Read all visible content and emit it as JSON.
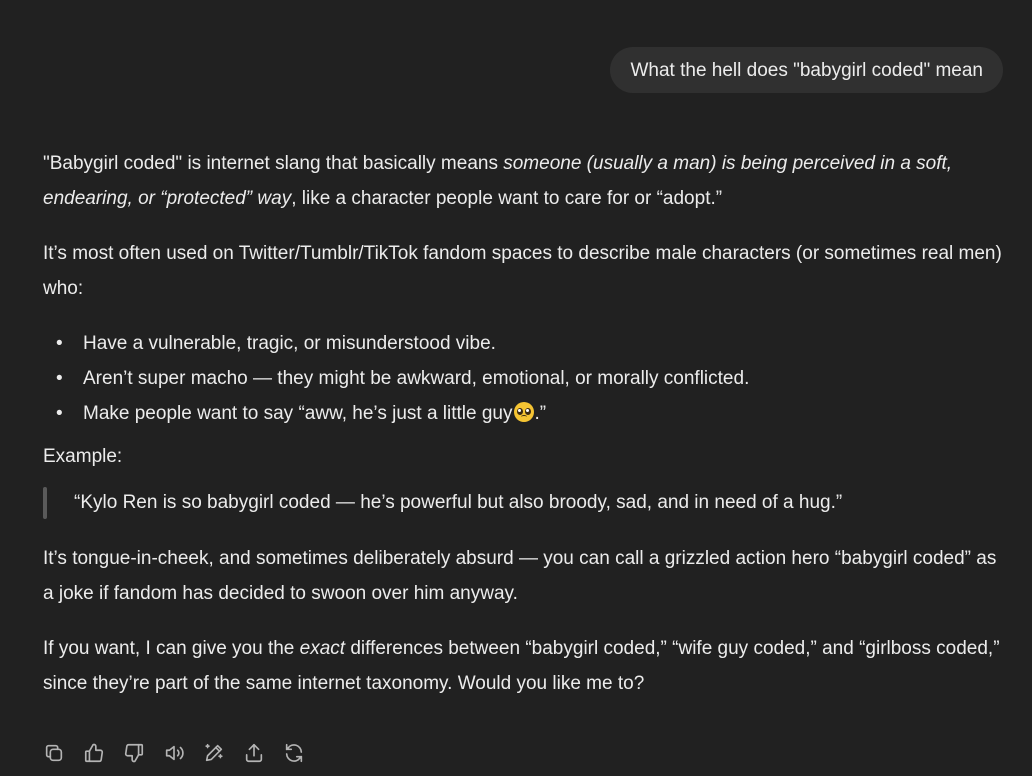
{
  "user_message": "What the hell does \"babygirl coded\" mean",
  "assistant": {
    "p1_before": "\"Babygirl coded\" is internet slang that basically means ",
    "p1_italic": "someone (usually a man) is being perceived in a soft, endearing, or “protected” way",
    "p1_after": ", like a character people want to care for or “adopt.”",
    "p2": "It’s most often used on Twitter/Tumblr/TikTok fandom spaces to describe male characters (or sometimes real men) who:",
    "bullets": [
      "Have a vulnerable, tragic, or misunderstood vibe.",
      "Aren’t super macho — they might be awkward, emotional, or morally conflicted.",
      "Make people want to say “aww, he’s just a little guy"
    ],
    "bullet3_after_emoji": ".”",
    "bullet_symbol": "•",
    "emoji_name": "pleading-face-emoji",
    "example_label": "Example:",
    "quote": "“Kylo Ren is so babygirl coded — he’s powerful but also broody, sad, and in need of a hug.”",
    "p3": "It’s tongue-in-cheek, and sometimes deliberately absurd — you can call a grizzled action hero “babygirl coded” as a joke if fandom has decided to swoon over him anyway.",
    "p4_before": "If you want, I can give you the ",
    "p4_italic": "exact",
    "p4_after": " differences between “babygirl coded,” “wife guy coded,” and “girlboss coded,” since they’re part of the same internet taxonomy. Would you like me to?"
  },
  "actions": [
    "copy-icon",
    "thumbs-up-icon",
    "thumbs-down-icon",
    "read-aloud-icon",
    "edit-icon",
    "share-icon",
    "regenerate-icon"
  ],
  "colors": {
    "background": "#212121",
    "user_bubble": "#303030",
    "text": "#ececec",
    "icon": "#b4b4b4",
    "quote_bar": "#5a5a5a"
  }
}
